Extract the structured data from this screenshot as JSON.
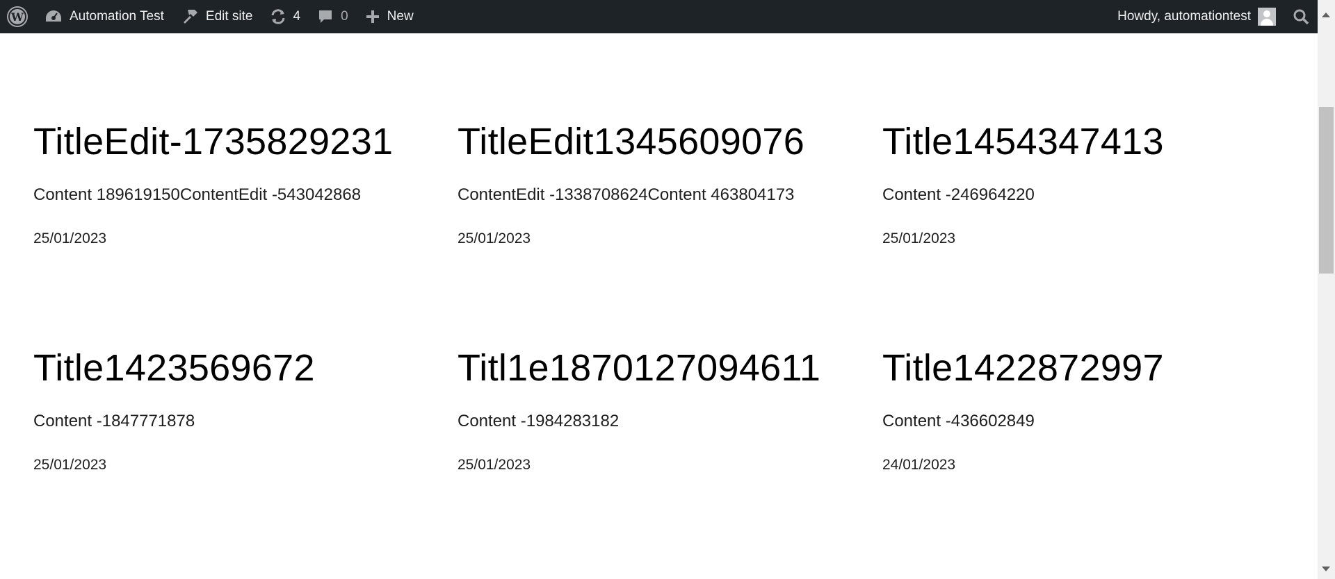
{
  "adminbar": {
    "site_name": "Automation Test",
    "edit_site": "Edit site",
    "updates_count": "4",
    "comments_count": "0",
    "new_label": "New",
    "howdy": "Howdy, automationtest"
  },
  "posts": [
    {
      "title": "TitleEdit-1735829231",
      "content": "Content 189619150ContentEdit -543042868",
      "date": "25/01/2023"
    },
    {
      "title": "TitleEdit1345609076",
      "content": "ContentEdit -1338708624Content 463804173",
      "date": "25/01/2023"
    },
    {
      "title": "Title1454347413",
      "content": "Content -246964220",
      "date": "25/01/2023"
    },
    {
      "title": "Title1423569672",
      "content": "Content -1847771878",
      "date": "25/01/2023"
    },
    {
      "title": "Titl1e1870127094611",
      "content": "Content -1984283182",
      "date": "25/01/2023"
    },
    {
      "title": "Title1422872997",
      "content": "Content -436602849",
      "date": "24/01/2023"
    }
  ],
  "icons": {
    "wordpress": "wordpress-logo-icon",
    "dashboard": "dashboard-icon",
    "edit": "hammer-icon",
    "updates": "updates-icon",
    "comments": "comment-icon",
    "new": "plus-icon",
    "search": "search-icon"
  },
  "colors": {
    "adminbar_bg": "#1d2327",
    "adminbar_text": "#f0f0f1",
    "page_bg": "#ffffff"
  }
}
